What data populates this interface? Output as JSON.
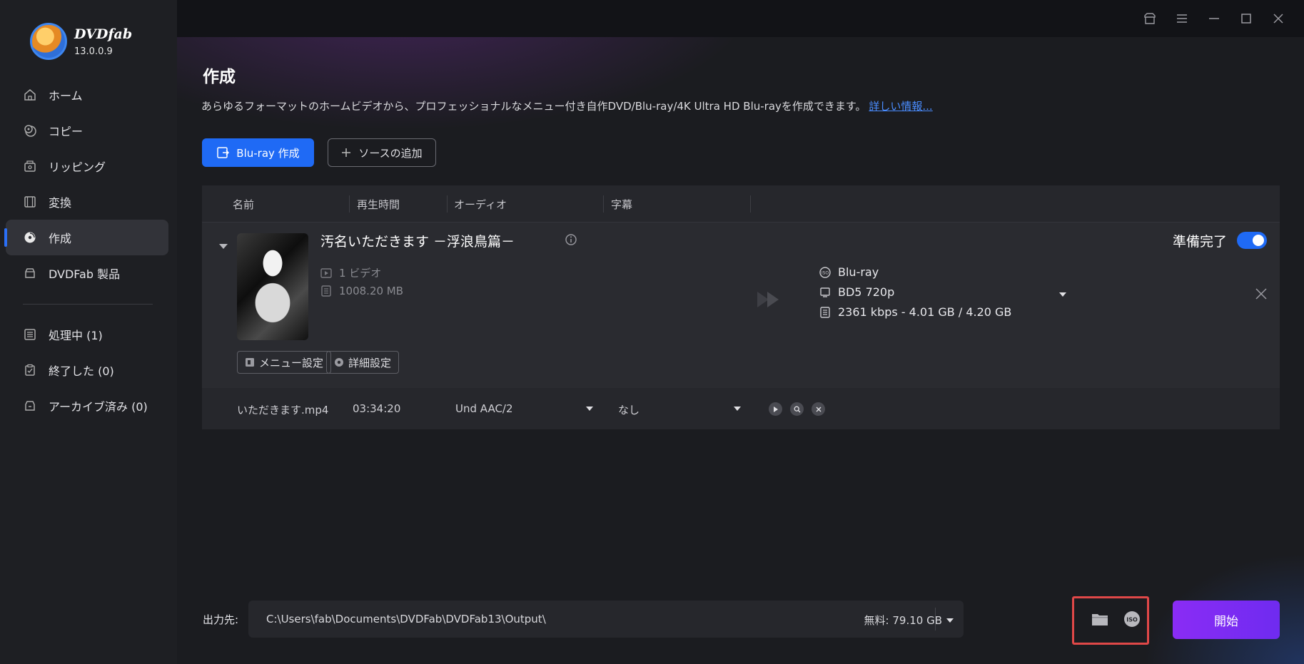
{
  "app": {
    "name": "DVDfab",
    "version": "13.0.0.9"
  },
  "sidebar": {
    "items": [
      {
        "label": "ホーム",
        "icon": "home-icon"
      },
      {
        "label": "コピー",
        "icon": "copy-disc-icon"
      },
      {
        "label": "リッピング",
        "icon": "ripper-icon"
      },
      {
        "label": "変換",
        "icon": "film-icon"
      },
      {
        "label": "作成",
        "icon": "creator-disc-icon",
        "active": true
      },
      {
        "label": "DVDFab 製品",
        "icon": "products-icon"
      }
    ],
    "tasks": [
      {
        "label": "処理中 (1)",
        "icon": "queue-icon"
      },
      {
        "label": "終了した (0)",
        "icon": "finished-icon"
      },
      {
        "label": "アーカイブ済み (0)",
        "icon": "archive-icon"
      }
    ]
  },
  "page": {
    "title": "作成",
    "description": "あらゆるフォーマットのホームビデオから、プロフェッショナルなメニュー付き自作DVD/Blu-ray/4K Ultra HD Blu-rayを作成できます。",
    "more_link": "詳しい情報..."
  },
  "toolbar": {
    "mode_button": "Blu-ray 作成",
    "add_source": "ソースの追加"
  },
  "table": {
    "headers": [
      "名前",
      "再生時間",
      "オーディオ",
      "字幕"
    ]
  },
  "item": {
    "title": "汚名いただきます －浮浪鳥篇－",
    "video_count": "1 ビデオ",
    "size": "1008.20 MB",
    "menu_button": "メニュー設定",
    "advanced_button": "詳細設定",
    "ready_label": "準備完了",
    "ready_enabled": true,
    "output_type": "Blu-ray",
    "output_format": "BD5 720p",
    "output_bitrate": "2361 kbps - 4.01 GB / 4.20 GB",
    "file": {
      "name": "いただきます.mp4",
      "duration": "03:34:20",
      "audio": "Und  AAC/2",
      "subtitle": "なし"
    }
  },
  "output": {
    "label": "出力先:",
    "path": "C:\\Users\\fab\\Documents\\DVDFab\\DVDFab13\\Output\\",
    "free_space": "無料: 79.10 GB"
  },
  "start_button": "開始",
  "colors": {
    "accent": "#1f6af5",
    "start": "#7b2cf3",
    "highlight": "#e04848"
  }
}
